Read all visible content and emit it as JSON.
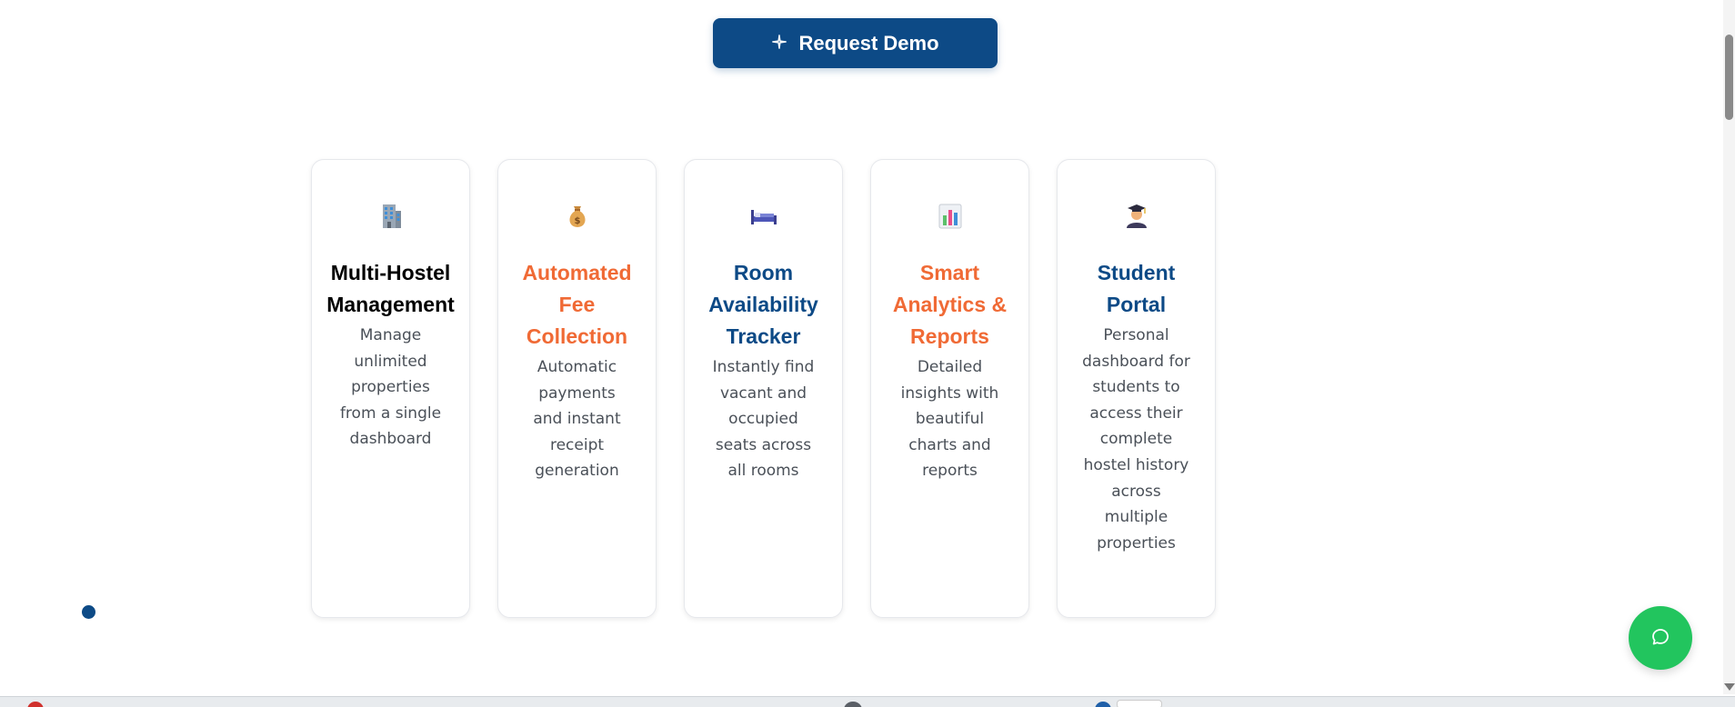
{
  "cta": {
    "label": "Request Demo",
    "icon": "sparkle-icon"
  },
  "features": [
    {
      "icon": "office-building-icon",
      "title": "Multi-Hostel Management",
      "title_color": "#0d4a86",
      "description": "Manage unlimited properties from a single dashboard"
    },
    {
      "icon": "money-bag-icon",
      "title": "Automated Fee Collection",
      "title_color": "#f06a35",
      "description": "Automatic payments and instant receipt generation"
    },
    {
      "icon": "bed-icon",
      "title": "Room Availability Tracker",
      "title_color": "#0d4a86",
      "description": "Instantly find vacant and occupied seats across all rooms"
    },
    {
      "icon": "bar-chart-icon",
      "title": "Smart Analytics & Reports",
      "title_color": "#f06a35",
      "description": "Detailed insights with beautiful charts and reports"
    },
    {
      "icon": "student-icon",
      "title": "Student Portal",
      "title_color": "#0d4a86",
      "description": "Personal dashboard for students to access their complete hostel history across multiple properties"
    }
  ],
  "chat": {
    "icon": "chat-bubble-icon"
  },
  "colors": {
    "primary": "#0d4a86",
    "accent": "#f06a35",
    "chat": "#22c55e"
  }
}
